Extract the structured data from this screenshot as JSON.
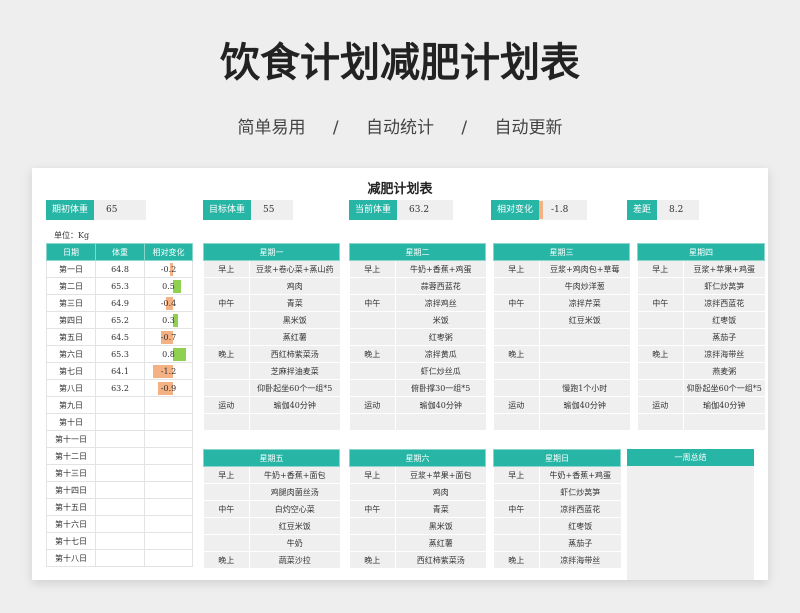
{
  "hero": {
    "title": "饮食计划减肥计划表",
    "tags": [
      "简单易用",
      "/",
      "自动统计",
      "/",
      "自动更新"
    ]
  },
  "sheet_title": "减肥计划表",
  "stats": [
    {
      "label": "期初体重",
      "value": "65"
    },
    {
      "label": "目标体重",
      "value": "55"
    },
    {
      "label": "当前体重",
      "value": "63.2"
    },
    {
      "label": "相对变化",
      "value": "-1.8"
    },
    {
      "label": "差距",
      "value": "8.2"
    }
  ],
  "unit": "单位：Kg",
  "log": {
    "headers": [
      "日期",
      "体重",
      "相对变化"
    ],
    "rows": [
      {
        "day": "第一日",
        "weight": "64.8",
        "change": "-0.2",
        "change_num": -0.2
      },
      {
        "day": "第二日",
        "weight": "65.3",
        "change": "0.5",
        "change_num": 0.5
      },
      {
        "day": "第三日",
        "weight": "64.9",
        "change": "-0.4",
        "change_num": -0.4
      },
      {
        "day": "第四日",
        "weight": "65.2",
        "change": "0.3",
        "change_num": 0.3
      },
      {
        "day": "第五日",
        "weight": "64.5",
        "change": "-0.7",
        "change_num": -0.7
      },
      {
        "day": "第六日",
        "weight": "65.3",
        "change": "0.8",
        "change_num": 0.8
      },
      {
        "day": "第七日",
        "weight": "64.1",
        "change": "-1.2",
        "change_num": -1.2
      },
      {
        "day": "第八日",
        "weight": "63.2",
        "change": "-0.9",
        "change_num": -0.9
      },
      {
        "day": "第九日",
        "weight": "",
        "change": "",
        "change_num": 0
      },
      {
        "day": "第十日",
        "weight": "",
        "change": "",
        "change_num": 0
      },
      {
        "day": "第十一日",
        "weight": "",
        "change": "",
        "change_num": 0
      },
      {
        "day": "第十二日",
        "weight": "",
        "change": "",
        "change_num": 0
      },
      {
        "day": "第十三日",
        "weight": "",
        "change": "",
        "change_num": 0
      },
      {
        "day": "第十四日",
        "weight": "",
        "change": "",
        "change_num": 0
      },
      {
        "day": "第十五日",
        "weight": "",
        "change": "",
        "change_num": 0
      },
      {
        "day": "第十六日",
        "weight": "",
        "change": "",
        "change_num": 0
      },
      {
        "day": "第十七日",
        "weight": "",
        "change": "",
        "change_num": 0
      },
      {
        "day": "第十八日",
        "weight": "",
        "change": "",
        "change_num": 0
      }
    ],
    "positive_color": "#8fd14f",
    "negative_color": "#f4b183",
    "bar_max": 1.2
  },
  "days_top": [
    {
      "name": "星期一",
      "rows": [
        [
          "早上",
          "豆浆+卷心菜+蒸山药"
        ],
        [
          "",
          "鸡肉"
        ],
        [
          "中午",
          "青菜"
        ],
        [
          "",
          "黑米饭"
        ],
        [
          "",
          "蒸红薯"
        ],
        [
          "晚上",
          "西红柿紫菜汤"
        ],
        [
          "",
          "芝麻拌油麦菜"
        ],
        [
          "",
          "仰卧起坐60个一组*5"
        ],
        [
          "运动",
          "瑜伽40分钟"
        ],
        [
          "",
          ""
        ]
      ]
    },
    {
      "name": "星期二",
      "rows": [
        [
          "早上",
          "牛奶+香蕉+鸡蛋"
        ],
        [
          "",
          "蒜蓉西蓝花"
        ],
        [
          "中午",
          "凉拌鸡丝"
        ],
        [
          "",
          "米饭"
        ],
        [
          "",
          "红枣粥"
        ],
        [
          "晚上",
          "凉拌黄瓜"
        ],
        [
          "",
          "虾仁炒丝瓜"
        ],
        [
          "",
          "俯卧撑30一组*5"
        ],
        [
          "运动",
          "瑜伽40分钟"
        ],
        [
          "",
          ""
        ]
      ]
    },
    {
      "name": "星期三",
      "rows": [
        [
          "早上",
          "豆浆+鸡肉包+草莓"
        ],
        [
          "",
          "牛肉炒洋葱"
        ],
        [
          "中午",
          "凉拌芹菜"
        ],
        [
          "",
          "红豆米饭"
        ],
        [
          "",
          ""
        ],
        [
          "晚上",
          ""
        ],
        [
          "",
          ""
        ],
        [
          "",
          "慢跑1个小时"
        ],
        [
          "运动",
          "瑜伽40分钟"
        ],
        [
          "",
          ""
        ]
      ]
    },
    {
      "name": "星期四",
      "rows": [
        [
          "早上",
          "豆浆+苹果+鸡蛋"
        ],
        [
          "",
          "虾仁炒莴笋"
        ],
        [
          "中午",
          "凉拌西蓝花"
        ],
        [
          "",
          "红枣饭"
        ],
        [
          "",
          "蒸茄子"
        ],
        [
          "晚上",
          "凉拌海带丝"
        ],
        [
          "",
          "燕麦粥"
        ],
        [
          "",
          "仰卧起坐60个一组*5"
        ],
        [
          "运动",
          "瑜伽40分钟"
        ],
        [
          "",
          ""
        ]
      ]
    }
  ],
  "days_bottom": [
    {
      "name": "星期五",
      "rows": [
        [
          "早上",
          "牛奶+香蕉+面包"
        ],
        [
          "",
          "鸡腿肉菌丝汤"
        ],
        [
          "中午",
          "白灼空心菜"
        ],
        [
          "",
          "红豆米饭"
        ],
        [
          "",
          "牛奶"
        ],
        [
          "晚上",
          "蔬菜沙拉"
        ]
      ]
    },
    {
      "name": "星期六",
      "rows": [
        [
          "早上",
          "豆浆+苹果+面包"
        ],
        [
          "",
          "鸡肉"
        ],
        [
          "中午",
          "青菜"
        ],
        [
          "",
          "黑米饭"
        ],
        [
          "",
          "蒸红薯"
        ],
        [
          "晚上",
          "西红柿紫菜汤"
        ]
      ]
    },
    {
      "name": "星期日",
      "rows": [
        [
          "早上",
          "牛奶+香蕉+鸡蛋"
        ],
        [
          "",
          "虾仁炒莴笋"
        ],
        [
          "中午",
          "凉拌西蓝花"
        ],
        [
          "",
          "红枣饭"
        ],
        [
          "",
          "蒸茄子"
        ],
        [
          "晚上",
          "凉拌海带丝"
        ]
      ]
    }
  ],
  "summary_title": "一周总结",
  "colors": {
    "accent": "#27b5a5",
    "cell_bg": "#efefef"
  }
}
